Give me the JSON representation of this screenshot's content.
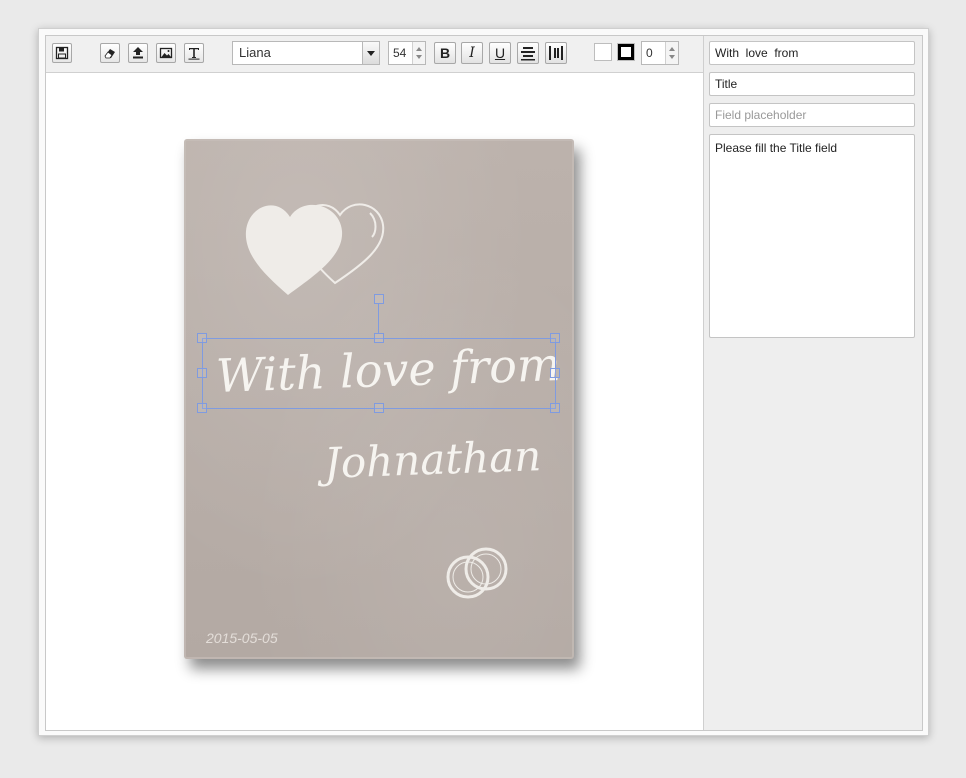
{
  "toolbar": {
    "buttons": [
      {
        "name": "save-icon"
      },
      {
        "name": "eraser-icon"
      },
      {
        "name": "upload-icon"
      },
      {
        "name": "image-icon"
      },
      {
        "name": "text-icon"
      }
    ],
    "font_family": "Liana",
    "font_size": "54",
    "bold_label": "B",
    "italic_label": "I",
    "underline_label": "U",
    "fill_color": "#ffffff",
    "stroke_color": "#000000",
    "stroke_width": "0"
  },
  "canvas": {
    "blanket_color": "#b8aea8",
    "line1": "With love from",
    "line2": "Johnathan",
    "date": "2015-05-05"
  },
  "side_panel": {
    "field1_value": "With  love  from",
    "field2_value": "Title",
    "field3_placeholder": "Field placeholder",
    "notes_value": "Please fill the Title field"
  }
}
